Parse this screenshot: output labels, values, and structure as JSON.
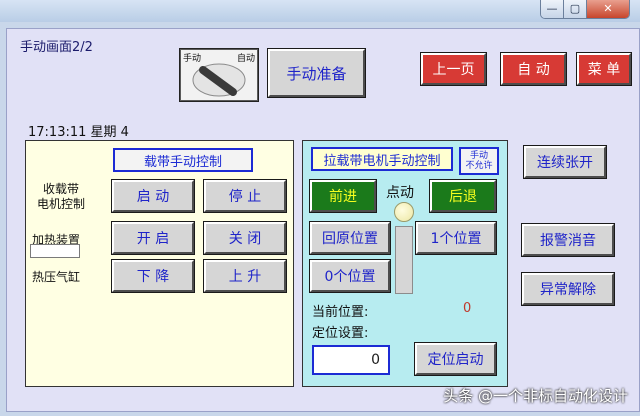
{
  "window": {
    "minimize": "—",
    "maximize": "▢",
    "close": "✕"
  },
  "screen": {
    "title": "手动画面2/2",
    "datetime": "17:13:11 星期 4"
  },
  "mode_switch": {
    "manual": "手动",
    "auto": "自动"
  },
  "header_buttons": {
    "manual_prepare": "手动准备",
    "prev_page": "上一页",
    "auto": "自 动",
    "menu": "菜 单"
  },
  "left_panel": {
    "title": "载带手动控制",
    "row1_label": "收载带\n电机控制",
    "start": "启 动",
    "stop": "停 止",
    "row2_label": "加热装置",
    "on": "开 启",
    "off": "关 闭",
    "row3_label": "热压气缸",
    "down": "下 降",
    "up": "上 升"
  },
  "mid_panel": {
    "title": "拉载带电机手动控制",
    "not_allowed": "手动\n不允许",
    "forward": "前进",
    "jog": "点动",
    "backward": "后退",
    "home": "回原位置",
    "pos1": "1个位置",
    "pos0": "0个位置",
    "current_pos_label": "当前位置:",
    "current_pos_value": "0",
    "pos_set_label": "定位设置:",
    "pos_set_value": "0",
    "pos_start": "定位启动"
  },
  "right_buttons": {
    "continuous_open": "连续张开",
    "alarm_mute": "报警消音",
    "fault_clear": "异常解除"
  },
  "watermark": "头条 @一个非标自动化设计",
  "colors": {
    "accent": "#1f24c9",
    "red_button": "#d73a35",
    "green_button": "#1b7a1b",
    "left_panel_bg": "#ffffe3",
    "mid_panel_bg": "#b7ecf0"
  }
}
